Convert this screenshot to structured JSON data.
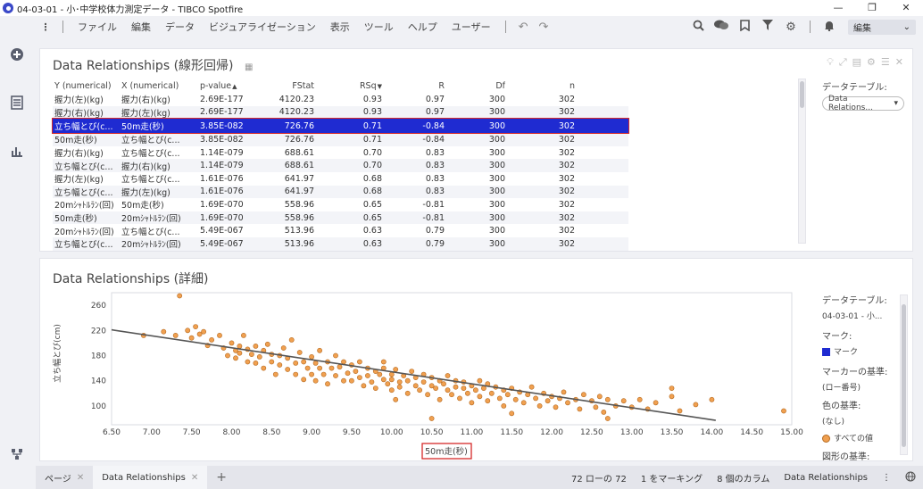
{
  "window": {
    "title": "04-03-01 - 小･中学校体力測定データ - TIBCO Spotfire",
    "minimize": "—",
    "restore": "❐",
    "close": "✕"
  },
  "menubar": {
    "items": [
      "ファイル",
      "編集",
      "データ",
      "ビジュアライゼーション",
      "表示",
      "ツール",
      "ヘルプ",
      "ユーザー"
    ],
    "edit_mode_label": "編集"
  },
  "table_panel": {
    "title": "Data Relationships (線形回帰)",
    "columns": [
      "Y (numerical)",
      "X (numerical)",
      "p-value",
      "FStat",
      "RSq",
      "R",
      "Df",
      "n"
    ],
    "rows": [
      [
        "握力(左)(kg)",
        "握力(右)(kg)",
        "2.69E-177",
        "4120.23",
        "0.93",
        "0.97",
        "300",
        "302"
      ],
      [
        "握力(右)(kg)",
        "握力(左)(kg)",
        "2.69E-177",
        "4120.23",
        "0.93",
        "0.97",
        "300",
        "302"
      ],
      [
        "立ち幅とび(c...",
        "50m走(秒)",
        "3.85E-082",
        "726.76",
        "0.71",
        "-0.84",
        "300",
        "302"
      ],
      [
        "50m走(秒)",
        "立ち幅とび(c...",
        "3.85E-082",
        "726.76",
        "0.71",
        "-0.84",
        "300",
        "302"
      ],
      [
        "握力(右)(kg)",
        "立ち幅とび(c...",
        "1.14E-079",
        "688.61",
        "0.70",
        "0.83",
        "300",
        "302"
      ],
      [
        "立ち幅とび(c...",
        "握力(右)(kg)",
        "1.14E-079",
        "688.61",
        "0.70",
        "0.83",
        "300",
        "302"
      ],
      [
        "握力(左)(kg)",
        "立ち幅とび(c...",
        "1.61E-076",
        "641.97",
        "0.68",
        "0.83",
        "300",
        "302"
      ],
      [
        "立ち幅とび(c...",
        "握力(左)(kg)",
        "1.61E-076",
        "641.97",
        "0.68",
        "0.83",
        "300",
        "302"
      ],
      [
        "20mｼｬﾄﾙﾗﾝ(回)",
        "50m走(秒)",
        "1.69E-070",
        "558.96",
        "0.65",
        "-0.81",
        "300",
        "302"
      ],
      [
        "50m走(秒)",
        "20mｼｬﾄﾙﾗﾝ(回)",
        "1.69E-070",
        "558.96",
        "0.65",
        "-0.81",
        "300",
        "302"
      ],
      [
        "20mｼｬﾄﾙﾗﾝ(回)",
        "立ち幅とび(c...",
        "5.49E-067",
        "513.96",
        "0.63",
        "0.79",
        "300",
        "302"
      ],
      [
        "立ち幅とび(c...",
        "20mｼｬﾄﾙﾗﾝ(回)",
        "5.49E-067",
        "513.96",
        "0.63",
        "0.79",
        "300",
        "302"
      ]
    ],
    "selected_row_index": 2,
    "side": {
      "data_table_label": "データテーブル:",
      "data_table_value": "Data Relations..."
    }
  },
  "detail_panel": {
    "title": "Data Relationships (詳細)",
    "side": {
      "data_table_label": "データテーブル:",
      "data_table_value": "04-03-01 - 小...",
      "marker_label": "マーク:",
      "marker_value": "マーク",
      "marker_basis_label": "マーカーの基準:",
      "marker_basis_value": "(ロー番号)",
      "color_basis_label": "色の基準:",
      "color_basis_value": "(なし)",
      "all_values_label": "すべての値",
      "shape_basis_label": "図形の基準:"
    }
  },
  "chart_data": {
    "type": "scatter",
    "xlabel": "50m走(秒)",
    "ylabel": "立ち幅とび(cm)",
    "xlim": [
      6.5,
      15.0
    ],
    "ylim": [
      70,
      280
    ],
    "xticks": [
      6.5,
      7.0,
      7.5,
      8.0,
      8.5,
      9.0,
      9.5,
      10.0,
      10.5,
      11.0,
      11.5,
      12.0,
      12.5,
      13.0,
      13.5,
      14.0,
      14.5,
      15.0
    ],
    "xtick_labels": [
      "6.50",
      "7.00",
      "7.50",
      "8.00",
      "8.50",
      "9.00",
      "9.50",
      "10.00",
      "10.50",
      "11.00",
      "11.50",
      "12.00",
      "12.50",
      "13.00",
      "13.50",
      "14.00",
      "14.50",
      "15.00"
    ],
    "yticks": [
      100,
      140,
      180,
      220,
      260
    ],
    "point_color": "#f0a050",
    "point_stroke": "#b66a20",
    "fit_line": {
      "x": [
        6.5,
        14.05
      ],
      "y": [
        221,
        77
      ],
      "color": "#555555"
    },
    "points": [
      [
        6.9,
        212
      ],
      [
        7.15,
        218
      ],
      [
        7.3,
        212
      ],
      [
        7.35,
        275
      ],
      [
        7.45,
        220
      ],
      [
        7.5,
        208
      ],
      [
        7.55,
        226
      ],
      [
        7.6,
        214
      ],
      [
        7.65,
        218
      ],
      [
        7.7,
        196
      ],
      [
        7.75,
        205
      ],
      [
        7.85,
        212
      ],
      [
        7.9,
        192
      ],
      [
        7.95,
        180
      ],
      [
        8.0,
        200
      ],
      [
        8.05,
        188
      ],
      [
        8.05,
        176
      ],
      [
        8.1,
        195
      ],
      [
        8.1,
        184
      ],
      [
        8.15,
        212
      ],
      [
        8.2,
        170
      ],
      [
        8.2,
        190
      ],
      [
        8.25,
        182
      ],
      [
        8.3,
        195
      ],
      [
        8.3,
        168
      ],
      [
        8.35,
        178
      ],
      [
        8.4,
        188
      ],
      [
        8.4,
        160
      ],
      [
        8.45,
        198
      ],
      [
        8.5,
        182
      ],
      [
        8.5,
        170
      ],
      [
        8.55,
        150
      ],
      [
        8.6,
        180
      ],
      [
        8.6,
        165
      ],
      [
        8.65,
        192
      ],
      [
        8.7,
        158
      ],
      [
        8.7,
        176
      ],
      [
        8.75,
        205
      ],
      [
        8.8,
        168
      ],
      [
        8.8,
        150
      ],
      [
        8.85,
        185
      ],
      [
        8.9,
        170
      ],
      [
        8.9,
        142
      ],
      [
        8.95,
        160
      ],
      [
        9.0,
        178
      ],
      [
        9.0,
        150
      ],
      [
        9.05,
        168
      ],
      [
        9.05,
        140
      ],
      [
        9.1,
        188
      ],
      [
        9.1,
        160
      ],
      [
        9.15,
        150
      ],
      [
        9.2,
        170
      ],
      [
        9.2,
        135
      ],
      [
        9.25,
        160
      ],
      [
        9.3,
        180
      ],
      [
        9.3,
        148
      ],
      [
        9.35,
        162
      ],
      [
        9.4,
        140
      ],
      [
        9.4,
        170
      ],
      [
        9.45,
        152
      ],
      [
        9.5,
        165
      ],
      [
        9.5,
        140
      ],
      [
        9.55,
        155
      ],
      [
        9.6,
        145
      ],
      [
        9.6,
        170
      ],
      [
        9.65,
        132
      ],
      [
        9.7,
        160
      ],
      [
        9.7,
        148
      ],
      [
        9.75,
        138
      ],
      [
        9.8,
        155
      ],
      [
        9.8,
        128
      ],
      [
        9.85,
        150
      ],
      [
        9.9,
        142
      ],
      [
        9.9,
        160
      ],
      [
        9.95,
        135
      ],
      [
        10.0,
        150
      ],
      [
        10.0,
        125
      ],
      [
        10.0,
        142
      ],
      [
        10.05,
        158
      ],
      [
        10.1,
        138
      ],
      [
        10.1,
        130
      ],
      [
        10.15,
        148
      ],
      [
        10.2,
        120
      ],
      [
        10.2,
        140
      ],
      [
        10.25,
        155
      ],
      [
        10.3,
        132
      ],
      [
        10.3,
        145
      ],
      [
        10.35,
        125
      ],
      [
        10.4,
        138
      ],
      [
        10.4,
        150
      ],
      [
        10.45,
        118
      ],
      [
        10.5,
        132
      ],
      [
        10.5,
        145
      ],
      [
        10.55,
        128
      ],
      [
        10.6,
        140
      ],
      [
        10.6,
        110
      ],
      [
        10.65,
        135
      ],
      [
        10.7,
        125
      ],
      [
        10.7,
        148
      ],
      [
        10.75,
        118
      ],
      [
        10.8,
        130
      ],
      [
        10.8,
        140
      ],
      [
        10.85,
        112
      ],
      [
        10.9,
        128
      ],
      [
        10.9,
        138
      ],
      [
        10.95,
        120
      ],
      [
        11.0,
        132
      ],
      [
        11.0,
        105
      ],
      [
        11.05,
        125
      ],
      [
        11.1,
        140
      ],
      [
        11.1,
        115
      ],
      [
        11.15,
        128
      ],
      [
        11.2,
        108
      ],
      [
        11.2,
        135
      ],
      [
        11.25,
        120
      ],
      [
        11.3,
        130
      ],
      [
        11.35,
        112
      ],
      [
        11.4,
        125
      ],
      [
        11.4,
        100
      ],
      [
        11.45,
        118
      ],
      [
        11.5,
        128
      ],
      [
        11.55,
        110
      ],
      [
        11.6,
        122
      ],
      [
        11.65,
        105
      ],
      [
        11.7,
        118
      ],
      [
        11.75,
        130
      ],
      [
        11.8,
        112
      ],
      [
        11.85,
        100
      ],
      [
        11.9,
        120
      ],
      [
        11.95,
        108
      ],
      [
        12.0,
        115
      ],
      [
        12.05,
        98
      ],
      [
        12.1,
        112
      ],
      [
        12.15,
        122
      ],
      [
        12.2,
        105
      ],
      [
        12.3,
        110
      ],
      [
        12.35,
        95
      ],
      [
        12.4,
        118
      ],
      [
        12.5,
        108
      ],
      [
        12.55,
        98
      ],
      [
        12.6,
        115
      ],
      [
        12.65,
        90
      ],
      [
        12.7,
        110
      ],
      [
        12.8,
        100
      ],
      [
        12.9,
        108
      ],
      [
        13.0,
        98
      ],
      [
        13.1,
        110
      ],
      [
        13.2,
        95
      ],
      [
        13.3,
        105
      ],
      [
        13.5,
        128
      ],
      [
        13.5,
        115
      ],
      [
        13.6,
        92
      ],
      [
        13.8,
        102
      ],
      [
        14.0,
        110
      ],
      [
        14.9,
        92
      ],
      [
        10.5,
        80
      ],
      [
        11.5,
        88
      ],
      [
        10.05,
        110
      ],
      [
        12.7,
        80
      ],
      [
        9.9,
        170
      ]
    ]
  },
  "bottombar": {
    "tab_pages": "ページ",
    "tab_active": "Data Relationships",
    "add": "+",
    "status_rows": "72 ローの 72",
    "status_marked": "1 をマーキング",
    "status_columns": "8 個のカラム",
    "status_table": "Data Relationships"
  }
}
